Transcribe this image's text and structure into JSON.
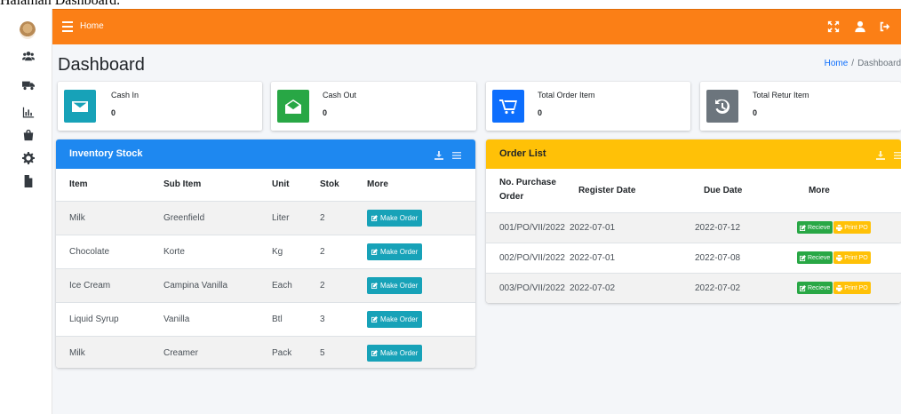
{
  "caption": "Halaman Dashboard.",
  "colors": {
    "topbar": "#fb7f16",
    "inventory_header": "#1e88f0",
    "order_header": "#ffc107",
    "cash_in": "#17a2b8",
    "cash_out": "#28a745",
    "total_order": "#0d6efd",
    "total_retur": "#6c757d"
  },
  "sidebar": {
    "icons": [
      "logo",
      "users-icon",
      "truck-icon",
      "chart-bar-icon",
      "shopping-bag-icon",
      "gear-icon",
      "file-icon"
    ]
  },
  "topbar": {
    "home_label": "Home",
    "right_icons": [
      "expand-icon",
      "user-icon",
      "logout-icon"
    ]
  },
  "page": {
    "title": "Dashboard",
    "breadcrumb_home": "Home",
    "breadcrumb_separator": "/",
    "breadcrumb_current": "Dashboard"
  },
  "info_boxes": [
    {
      "label": "Cash In",
      "value": "0",
      "icon": "envelope-icon"
    },
    {
      "label": "Cash Out",
      "value": "0",
      "icon": "envelope-open-icon"
    },
    {
      "label": "Total Order Item",
      "value": "0",
      "icon": "cart-icon"
    },
    {
      "label": "Total Retur Item",
      "value": "0",
      "icon": "history-icon"
    }
  ],
  "inventory": {
    "title": "Inventory Stock",
    "columns": [
      "Item",
      "Sub Item",
      "Unit",
      "Stok",
      "More"
    ],
    "action_label": "Make Order",
    "rows": [
      {
        "item": "Milk",
        "sub_item": "Greenfield",
        "unit": "Liter",
        "stok": "2"
      },
      {
        "item": "Chocolate",
        "sub_item": "Korte",
        "unit": "Kg",
        "stok": "2"
      },
      {
        "item": "Ice Cream",
        "sub_item": "Campina Vanilla",
        "unit": "Each",
        "stok": "2"
      },
      {
        "item": "Liquid Syrup",
        "sub_item": "Vanilla",
        "unit": "Btl",
        "stok": "3"
      },
      {
        "item": "Milk",
        "sub_item": "Creamer",
        "unit": "Pack",
        "stok": "5"
      }
    ]
  },
  "orders": {
    "title": "Order List",
    "columns": [
      "No. Purchase Order",
      "Register Date",
      "Due Date",
      "More"
    ],
    "receive_label": "Recieve",
    "print_label": "Print PO",
    "rows": [
      {
        "po": "001/PO/VII/2022",
        "register": "2022-07-01",
        "due": "2022-07-12"
      },
      {
        "po": "002/PO/VII/2022",
        "register": "2022-07-01",
        "due": "2022-07-08"
      },
      {
        "po": "003/PO/VII/2022",
        "register": "2022-07-02",
        "due": "2022-07-02"
      }
    ]
  }
}
